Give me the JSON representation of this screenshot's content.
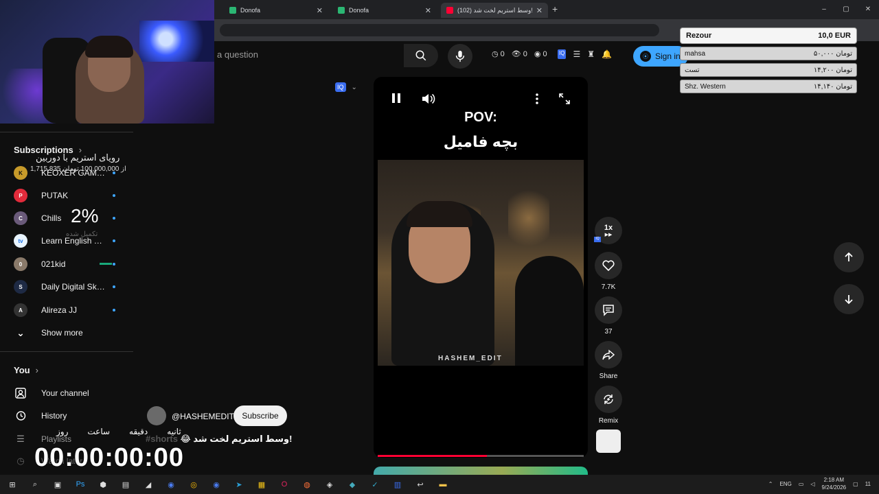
{
  "browser": {
    "tabs": [
      {
        "title": "Donofa",
        "favicon_color": "#2bb673"
      },
      {
        "title": "Donofa",
        "favicon_color": "#2bb673"
      },
      {
        "title": "(102) وسط استریم لخت شد!",
        "favicon_color": "#ff0033"
      }
    ],
    "new_tab": "+",
    "window_controls": [
      "–",
      "▢",
      "✕"
    ]
  },
  "search": {
    "placeholder": "a question"
  },
  "stats": {
    "a": "0",
    "b": "0",
    "c": "0"
  },
  "signin": {
    "label": "Sign in"
  },
  "donation": {
    "header_name": "Rezour",
    "header_amount": "10,0 EUR",
    "rows": [
      {
        "name": "mahsa",
        "amount": "۵۰,۰۰۰ تومان"
      },
      {
        "name": "تست",
        "amount": "۱۴,۲۰۰ تومان"
      },
      {
        "name": "Shz. Western",
        "amount": "۱۴,۱۴۰ تومان"
      }
    ]
  },
  "sidebar": {
    "subscriptions_title": "Subscriptions",
    "subscriptions": [
      {
        "name": "KEOXER GAMING",
        "color": "#c79a2a",
        "glyph": "K"
      },
      {
        "name": "PUTAK",
        "color": "#e22b3b",
        "glyph": "P"
      },
      {
        "name": "Chills",
        "color": "#6a5a7a",
        "glyph": "C"
      },
      {
        "name": "Learn English Wi...",
        "color": "#e8f4ff",
        "glyph": "tv"
      },
      {
        "name": "021kid",
        "color": "#8a7a6a",
        "glyph": "0"
      },
      {
        "name": "Daily Digital Skill...",
        "color": "#1e2a44",
        "glyph": "S"
      },
      {
        "name": "Alireza JJ",
        "color": "#333333",
        "glyph": "A"
      }
    ],
    "show_more": "Show more",
    "you_title": "You",
    "you_items": [
      "Your channel",
      "History",
      "Playlists",
      "Watch later"
    ]
  },
  "goal": {
    "title": "رویای استریم با دوربین",
    "amount": "1,715,835 از 100,000,000 تومان",
    "percent": "2%",
    "subtitle": "تکمیل شده"
  },
  "timer": {
    "labels": [
      "روز",
      "ساعت",
      "دقیقه",
      "ثانیه"
    ],
    "value": "00:00:00:00"
  },
  "player": {
    "pov": "POV:",
    "pov_sub": "بچه فامیل",
    "watermark": "HASHEM_EDIT",
    "progress": 0.53
  },
  "channel": {
    "name": "@HASHEMEDIT",
    "subscribe": "Subscribe",
    "title": "وسط استریم لخت شد!",
    "hashtag": "#shorts",
    "emoji": "😂"
  },
  "actions": {
    "speed": "1x",
    "likes": "7.7K",
    "comments": "37",
    "share": "Share",
    "remix": "Remix"
  },
  "taskbar": {
    "lang": "ENG",
    "time": "2:18 AM",
    "date": "9/24/2026",
    "notif": "11"
  }
}
